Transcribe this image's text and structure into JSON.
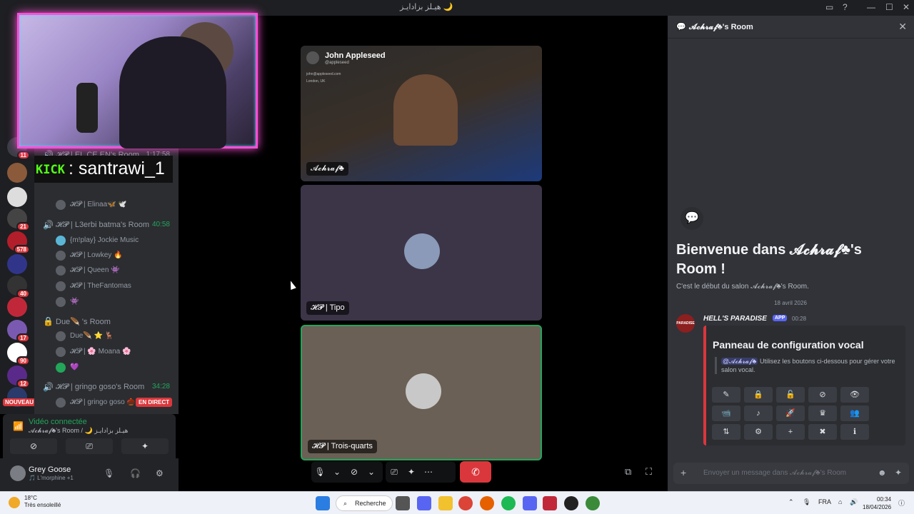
{
  "window": {
    "title": "هيـلز بزادايـز 🌙",
    "controls": [
      "▭",
      "?",
      "—",
      "☐",
      "✕"
    ]
  },
  "sidebar": {
    "channels": [
      {
        "name": "𝓗𝓟 | EL.CE.EN's Room",
        "time": "1:17:58"
      },
      {
        "name": "𝓗𝓟 | L3erbi batma's Room",
        "time": "40:58"
      },
      {
        "name": "Due🪶 's Room",
        "time": ""
      },
      {
        "name": "𝓗𝓟 | gringo goso's Room",
        "time": "34:28"
      }
    ],
    "users": [
      {
        "name": "𝓗𝓟 | Elinaa🦋 🕊️"
      },
      {
        "name": "{m!play} Jockie Music"
      },
      {
        "name": "𝓗𝓟 | Lowkey 🔥"
      },
      {
        "name": "𝓗𝓟 | Queen 👾"
      },
      {
        "name": "𝓗𝓟 | TheFantomas"
      },
      {
        "name": "👾"
      },
      {
        "name": "Due🪶 ⭐ 🦌"
      },
      {
        "name": "𝓗𝓟 | 🌸 Moana 🌸"
      },
      {
        "name": "💜"
      },
      {
        "name": "𝓗𝓟 | gringo goso 🌰"
      }
    ],
    "live_badge": "EN DIRECT",
    "server_badges": [
      "11",
      "21",
      "578",
      "40",
      "17",
      "90",
      "12"
    ],
    "nouveau": "NOUVEAU"
  },
  "voice": {
    "status": "Vidéo connectée",
    "channel": "𝓐𝓬𝓱𝓻𝓪𝓯♣'s Room / 🌙 هيـلز بزادايـز"
  },
  "user": {
    "name": "Grey Goose",
    "status": "🎵 L'morphine +1"
  },
  "stage": {
    "tiles": [
      {
        "label": "𝓐𝓬𝓱𝓻𝓪𝓯♣",
        "card_name": "John Appleseed",
        "card_handle": "@appleseed",
        "card_email": "john@appleseed.com",
        "card_loc": "London, UK"
      },
      {
        "label": "𝓗𝓟 | Tipo"
      },
      {
        "label": "𝓗𝓟 | Trois-quarts"
      }
    ]
  },
  "right": {
    "title": "𝓐𝓬𝓱𝓻𝓪𝓯♣'s Room",
    "welcome": "Bienvenue dans 𝓐𝓬𝓱𝓻𝓪𝓯♣'s Room !",
    "welcome_sub": "C'est le début du salon 𝓐𝓬𝓱𝓻𝓪𝓯♣'s Room.",
    "date": "18 avril 2026",
    "bot_name": "HELL'S PARADISE",
    "bot_tag": "APP",
    "bot_time": "00:28",
    "bot_avatar_text": "PARADISE",
    "embed_title": "Panneau de configuration vocal",
    "embed_mention": "@𝓐𝓬𝓱𝓻𝓪𝓯♣",
    "embed_desc": " Utilisez les boutons ci-dessous pour gérer votre salon vocal.",
    "embed_buttons": [
      "✎",
      "🔒",
      "🔓",
      "⊘",
      "👁",
      "📹",
      "♪",
      "🚀",
      "♛",
      "👥",
      "⇅",
      "⚙",
      "+",
      "✖",
      "ℹ"
    ],
    "composer_placeholder": "Envoyer un message dans 𝓐𝓬𝓱𝓻𝓪𝓯♣'s Room"
  },
  "overlay": {
    "kick_logo": "KICK",
    "kick_user": ": santrawi_1"
  },
  "taskbar": {
    "temp": "18°C",
    "weather": "Très ensoleillé",
    "search": "Recherche",
    "lang": "FRA",
    "time": "00:34",
    "date": "18/04/2026"
  }
}
